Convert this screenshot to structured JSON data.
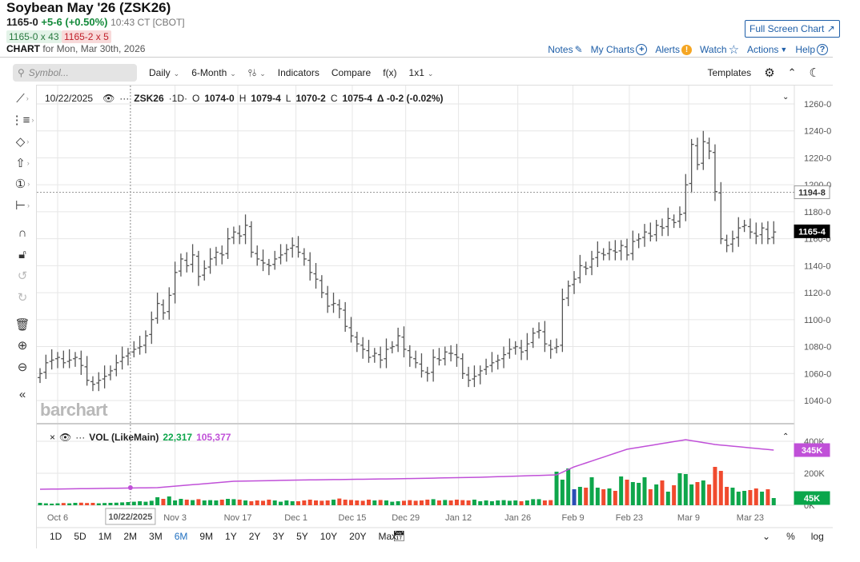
{
  "header": {
    "title": "Soybean May '26 (ZSK26)",
    "last": "1165-0",
    "change": "+5-6 (+0.50%)",
    "time": "10:43 CT [CBOT]",
    "bid": "1165-0 x 43",
    "ask": "1165-2 x 5",
    "chart_label": "CHART",
    "chart_for": "for Mon, Mar 30th, 2026",
    "full_screen": "Full Screen Chart"
  },
  "links": {
    "notes": "Notes",
    "my_charts": "My Charts",
    "alerts": "Alerts",
    "watch": "Watch",
    "actions": "Actions",
    "help": "Help"
  },
  "toolbar": {
    "search_placeholder": "Symbol...",
    "interval": "Daily",
    "period": "6-Month",
    "indicators": "Indicators",
    "compare": "Compare",
    "fx": "f(x)",
    "layout": "1x1",
    "templates": "Templates"
  },
  "legend": {
    "date": "10/22/2025",
    "symbol": "ZSK26",
    "tf": "·1D·",
    "o_label": "O",
    "o": "1074-0",
    "h_label": "H",
    "h": "1079-4",
    "l_label": "L",
    "l": "1070-2",
    "c_label": "C",
    "c": "1075-4",
    "delta": "Δ -0-2 (-0.02%)"
  },
  "vol_legend": {
    "name": "VOL (LikeMain)",
    "vol": "22,317",
    "ma": "105,377"
  },
  "logo": "barchart",
  "price_axis": {
    "labels": [
      "1260-0",
      "1240-0",
      "1220-0",
      "1200-0",
      "1180-0",
      "1160-0",
      "1140-0",
      "1120-0",
      "1100-0",
      "1080-0",
      "1060-0",
      "1040-0"
    ],
    "crosshair": "1194-8",
    "last": "1165-4"
  },
  "vol_axis": {
    "labels": [
      "400K",
      "200K",
      "0K"
    ],
    "ma_tag": "345K",
    "vol_tag": "45K"
  },
  "cursor_date": "10/22/2025",
  "ranges": [
    "1D",
    "5D",
    "1M",
    "2M",
    "3M",
    "6M",
    "9M",
    "1Y",
    "2Y",
    "3Y",
    "5Y",
    "10Y",
    "20Y",
    "Max"
  ],
  "active_range": "6M",
  "bottom_right": {
    "pct": "%",
    "log": "log"
  },
  "colors": {
    "up": "#0ea64b",
    "down": "#f04a2e",
    "neutral": "#2a4db5",
    "bar": "#555555",
    "ma": "#c050d8",
    "link": "#1f5fa8"
  },
  "chart_data": {
    "type": "ohlc",
    "ylim": [
      1030,
      1270
    ],
    "close": [
      1060,
      1068,
      1070,
      1072,
      1068,
      1070,
      1072,
      1066,
      1055,
      1052,
      1055,
      1058,
      1062,
      1068,
      1072,
      1075,
      1078,
      1080,
      1088,
      1100,
      1112,
      1105,
      1118,
      1135,
      1145,
      1140,
      1148,
      1132,
      1138,
      1145,
      1150,
      1148,
      1160,
      1165,
      1162,
      1170,
      1150,
      1145,
      1142,
      1140,
      1145,
      1148,
      1152,
      1155,
      1150,
      1145,
      1135,
      1130,
      1120,
      1110,
      1112,
      1108,
      1095,
      1088,
      1082,
      1078,
      1072,
      1075,
      1070,
      1078,
      1080,
      1088,
      1078,
      1072,
      1068,
      1062,
      1060,
      1072,
      1070,
      1076,
      1075,
      1072,
      1060,
      1055,
      1058,
      1062,
      1065,
      1068,
      1070,
      1074,
      1078,
      1080,
      1076,
      1082,
      1090,
      1092,
      1082,
      1078,
      1080,
      1115,
      1125,
      1130,
      1140,
      1138,
      1145,
      1150,
      1148,
      1152,
      1150,
      1155,
      1148,
      1158,
      1160,
      1165,
      1162,
      1170,
      1168,
      1175,
      1172,
      1178,
      1200,
      1230,
      1215,
      1232,
      1225,
      1195,
      1160,
      1155,
      1160,
      1168,
      1170,
      1165,
      1162,
      1168,
      1160,
      1165
    ],
    "volume_k": [
      15,
      12,
      10,
      12,
      14,
      12,
      15,
      16,
      14,
      15,
      12,
      14,
      15,
      16,
      18,
      20,
      22,
      25,
      22,
      28,
      50,
      40,
      55,
      30,
      40,
      35,
      32,
      38,
      30,
      32,
      30,
      35,
      40,
      38,
      35,
      30,
      25,
      30,
      28,
      35,
      30,
      22,
      30,
      25,
      25,
      30,
      35,
      30,
      28,
      30,
      35,
      42,
      35,
      33,
      30,
      28,
      35,
      30,
      33,
      30,
      22,
      25,
      28,
      32,
      28,
      30,
      35,
      38,
      30,
      33,
      30,
      35,
      32,
      30,
      35,
      25,
      30,
      25,
      30,
      32,
      28,
      30,
      25,
      30,
      38,
      38,
      30,
      32,
      210,
      160,
      230,
      100,
      115,
      110,
      175,
      110,
      100,
      105,
      90,
      180,
      160,
      145,
      140,
      175,
      100,
      130,
      155,
      85,
      125,
      200,
      195,
      130,
      145,
      155,
      130,
      240,
      215,
      115,
      110,
      85,
      90,
      95,
      105,
      85,
      100,
      45
    ],
    "volume_ma_k": {
      "bar_index": [
        0,
        20,
        33,
        45,
        60,
        75,
        88,
        91,
        100,
        110,
        115,
        125
      ],
      "value": [
        100,
        110,
        150,
        158,
        165,
        175,
        190,
        240,
        350,
        410,
        380,
        345
      ]
    },
    "neutral_bar_index": 91,
    "vol_ylim": [
      0,
      460
    ],
    "x_ticks": [
      {
        "label": "Oct 6",
        "i": 3
      },
      {
        "label": "Nov 3",
        "i": 23
      },
      {
        "label": "Nov 17",
        "i": 33.7
      },
      {
        "label": "Dec 1",
        "i": 43.6
      },
      {
        "label": "Dec 15",
        "i": 53.2
      },
      {
        "label": "Dec 29",
        "i": 62.3
      },
      {
        "label": "Jan 12",
        "i": 71.3
      },
      {
        "label": "Jan 26",
        "i": 81.4
      },
      {
        "label": "Feb 9",
        "i": 90.8
      },
      {
        "label": "Feb 23",
        "i": 100.4
      },
      {
        "label": "Mar 9",
        "i": 110.5
      },
      {
        "label": "Mar 23",
        "i": 121
      }
    ],
    "cursor_index": 15.4,
    "crosshair_price": 1194.5
  }
}
